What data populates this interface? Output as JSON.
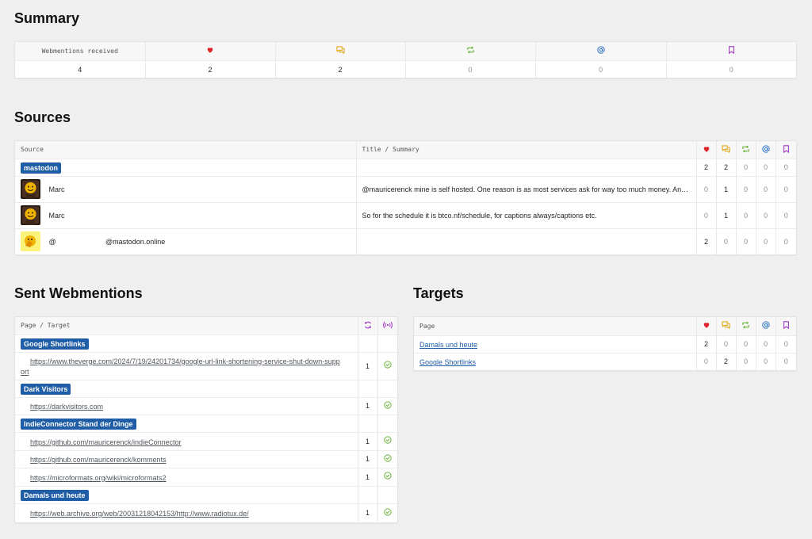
{
  "colors": {
    "heart": "#e0242b",
    "reply": "#e0a91b",
    "repost": "#6bb43b",
    "mention": "#2c74c7",
    "bookmark": "#a038c4",
    "badge": "#1f5da6",
    "check": "#6bb43b"
  },
  "summary": {
    "title": "Summary",
    "label": "Webmentions received",
    "icons": [
      "heart-icon",
      "reply-icon",
      "repost-icon",
      "mention-icon",
      "bookmark-icon"
    ],
    "total": "4",
    "counts": [
      "2",
      "2",
      "0",
      "0",
      "0"
    ]
  },
  "sources": {
    "title": "Sources",
    "col_source": "Source",
    "col_title": "Title / Summary",
    "rows": [
      {
        "type": "badge",
        "source": "mastodon",
        "summary": "",
        "counts": [
          "2",
          "2",
          "0",
          "0",
          "0"
        ]
      },
      {
        "type": "user",
        "avatar": "face-dark",
        "source": "Marc",
        "summary": "@mauricerenck mine is self hosted. One reason is as most services ask for way too much money. An…",
        "counts": [
          "0",
          "1",
          "0",
          "0",
          "0"
        ]
      },
      {
        "type": "user",
        "avatar": "face-dark",
        "source": "Marc",
        "summary": "So for the schedule it is btco.nf/schedule, for captions always/captions etc.",
        "counts": [
          "0",
          "1",
          "0",
          "0",
          "0"
        ]
      },
      {
        "type": "user",
        "avatar": "face-yellow",
        "source_prefix": "@",
        "source": "@mastodon.online",
        "summary": "",
        "counts": [
          "2",
          "0",
          "0",
          "0",
          "0"
        ]
      }
    ]
  },
  "sent": {
    "title": "Sent Webmentions",
    "col_page": "Page / Target",
    "rows": [
      {
        "type": "badge",
        "label": "Google Shortlinks"
      },
      {
        "type": "link",
        "label": "https://www.theverge.com/2024/7/19/24201734/google-url-link-shortening-service-shut-down-support",
        "count": "1"
      },
      {
        "type": "badge",
        "label": "Dark Visitors"
      },
      {
        "type": "link",
        "label": "https://darkvisitors.com",
        "count": "1"
      },
      {
        "type": "badge",
        "label": "IndieConnector Stand der Dinge"
      },
      {
        "type": "link",
        "label": "https://github.com/mauricerenck/indieConnector",
        "count": "1"
      },
      {
        "type": "link",
        "label": "https://github.com/mauricerenck/komments",
        "count": "1"
      },
      {
        "type": "link",
        "label": "https://microformats.org/wiki/microformats2",
        "count": "1"
      },
      {
        "type": "badge",
        "label": "Damals und heute"
      },
      {
        "type": "link",
        "label": "https://web.archive.org/web/20031218042153/http://www.radiotux.de/",
        "count": "1"
      }
    ]
  },
  "targets": {
    "title": "Targets",
    "col_page": "Page",
    "rows": [
      {
        "label": "Damals und heute",
        "counts": [
          "2",
          "0",
          "0",
          "0",
          "0"
        ]
      },
      {
        "label": "Google Shortlinks",
        "counts": [
          "0",
          "2",
          "0",
          "0",
          "0"
        ]
      }
    ]
  }
}
